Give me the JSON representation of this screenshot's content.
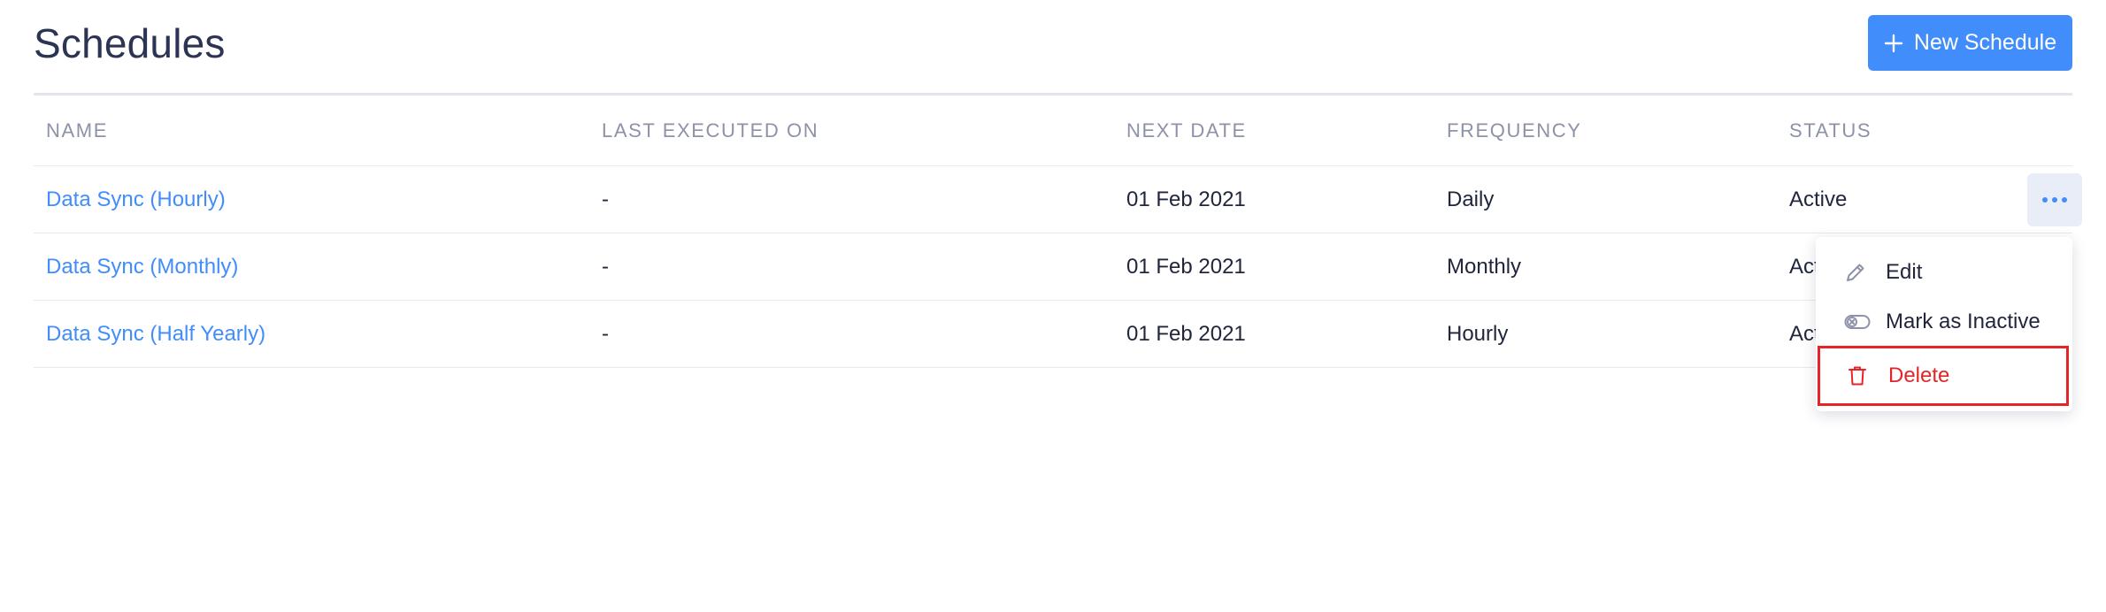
{
  "page": {
    "title": "Schedules",
    "new_button_label": "New Schedule"
  },
  "table": {
    "columns": [
      "NAME",
      "LAST EXECUTED ON",
      "NEXT DATE",
      "FREQUENCY",
      "STATUS"
    ],
    "rows": [
      {
        "name": "Data Sync (Hourly)",
        "last_executed": "-",
        "next_date": "01 Feb 2021",
        "frequency": "Daily",
        "status": "Active"
      },
      {
        "name": "Data Sync (Monthly)",
        "last_executed": "-",
        "next_date": "01 Feb 2021",
        "frequency": "Monthly",
        "status": "Active"
      },
      {
        "name": "Data Sync (Half Yearly)",
        "last_executed": "-",
        "next_date": "01 Feb 2021",
        "frequency": "Hourly",
        "status": "Active"
      }
    ]
  },
  "row_menu": {
    "items": [
      {
        "label": "Edit",
        "icon": "pencil-icon"
      },
      {
        "label": "Mark as Inactive",
        "icon": "toggle-off-icon"
      },
      {
        "label": "Delete",
        "icon": "trash-icon",
        "highlighted": true
      }
    ]
  },
  "colors": {
    "accent": "#408dfb",
    "danger": "#e42527",
    "text": "#21263c",
    "header_text": "#8d92a8"
  },
  "icons": {
    "new_button": "plus-icon",
    "row_actions": "more-horizontal-icon"
  }
}
